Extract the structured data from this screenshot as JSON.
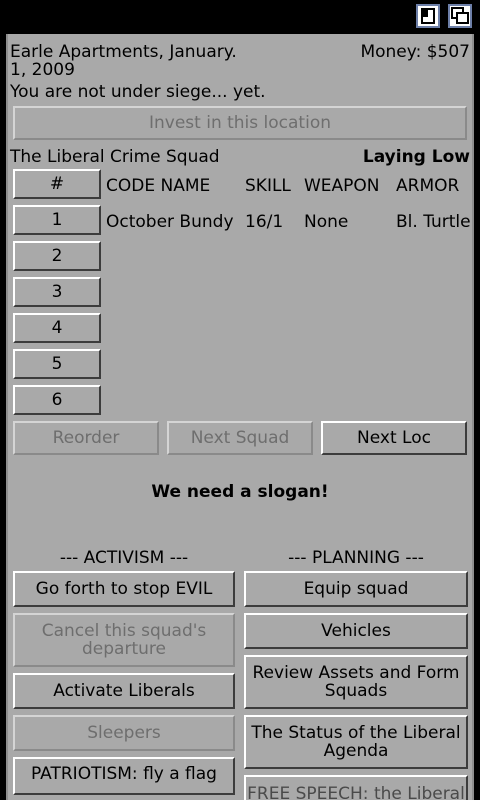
{
  "window": {
    "buttons": [
      "restore-icon",
      "cascade-icon"
    ],
    "title_bar_color": "#000000",
    "panel_color": "#a9a9a9"
  },
  "location": {
    "line1": "Earle Apartments, January.",
    "line2": "1, 2009",
    "money": "Money: $507"
  },
  "siege_status": "You are not under siege...  yet.",
  "invest_button": "Invest in this location",
  "squad": {
    "name": "The Liberal Crime Squad",
    "status": "Laying Low"
  },
  "table": {
    "headers": {
      "num": "#",
      "code_name": "CODE NAME",
      "skill": "SKILL",
      "weapon": "WEAPON",
      "armor": "ARMOR"
    },
    "slots": [
      "1",
      "2",
      "3",
      "4",
      "5",
      "6"
    ],
    "member": {
      "code_name": "October Bundy",
      "skill": "16/1",
      "weapon": "None",
      "armor": "Bl. Turtle"
    }
  },
  "nav": {
    "reorder": "Reorder",
    "next_squad": "Next Squad",
    "next_loc": "Next Loc"
  },
  "slogan": "We need a slogan!",
  "activism": {
    "header": "--- ACTIVISM ---",
    "go_forth": "Go forth to stop EVIL",
    "cancel_departure": "Cancel this squad's departure",
    "activate": "Activate Liberals",
    "sleepers": "Sleepers",
    "patriotism": "PATRIOTISM: fly a flag"
  },
  "planning": {
    "header": "--- PLANNING ---",
    "equip": "Equip squad",
    "vehicles": "Vehicles",
    "review": "Review Assets and Form Squads",
    "status": "The Status of the Liberal Agenda",
    "partial": "FREE SPEECH: the Liberal"
  }
}
